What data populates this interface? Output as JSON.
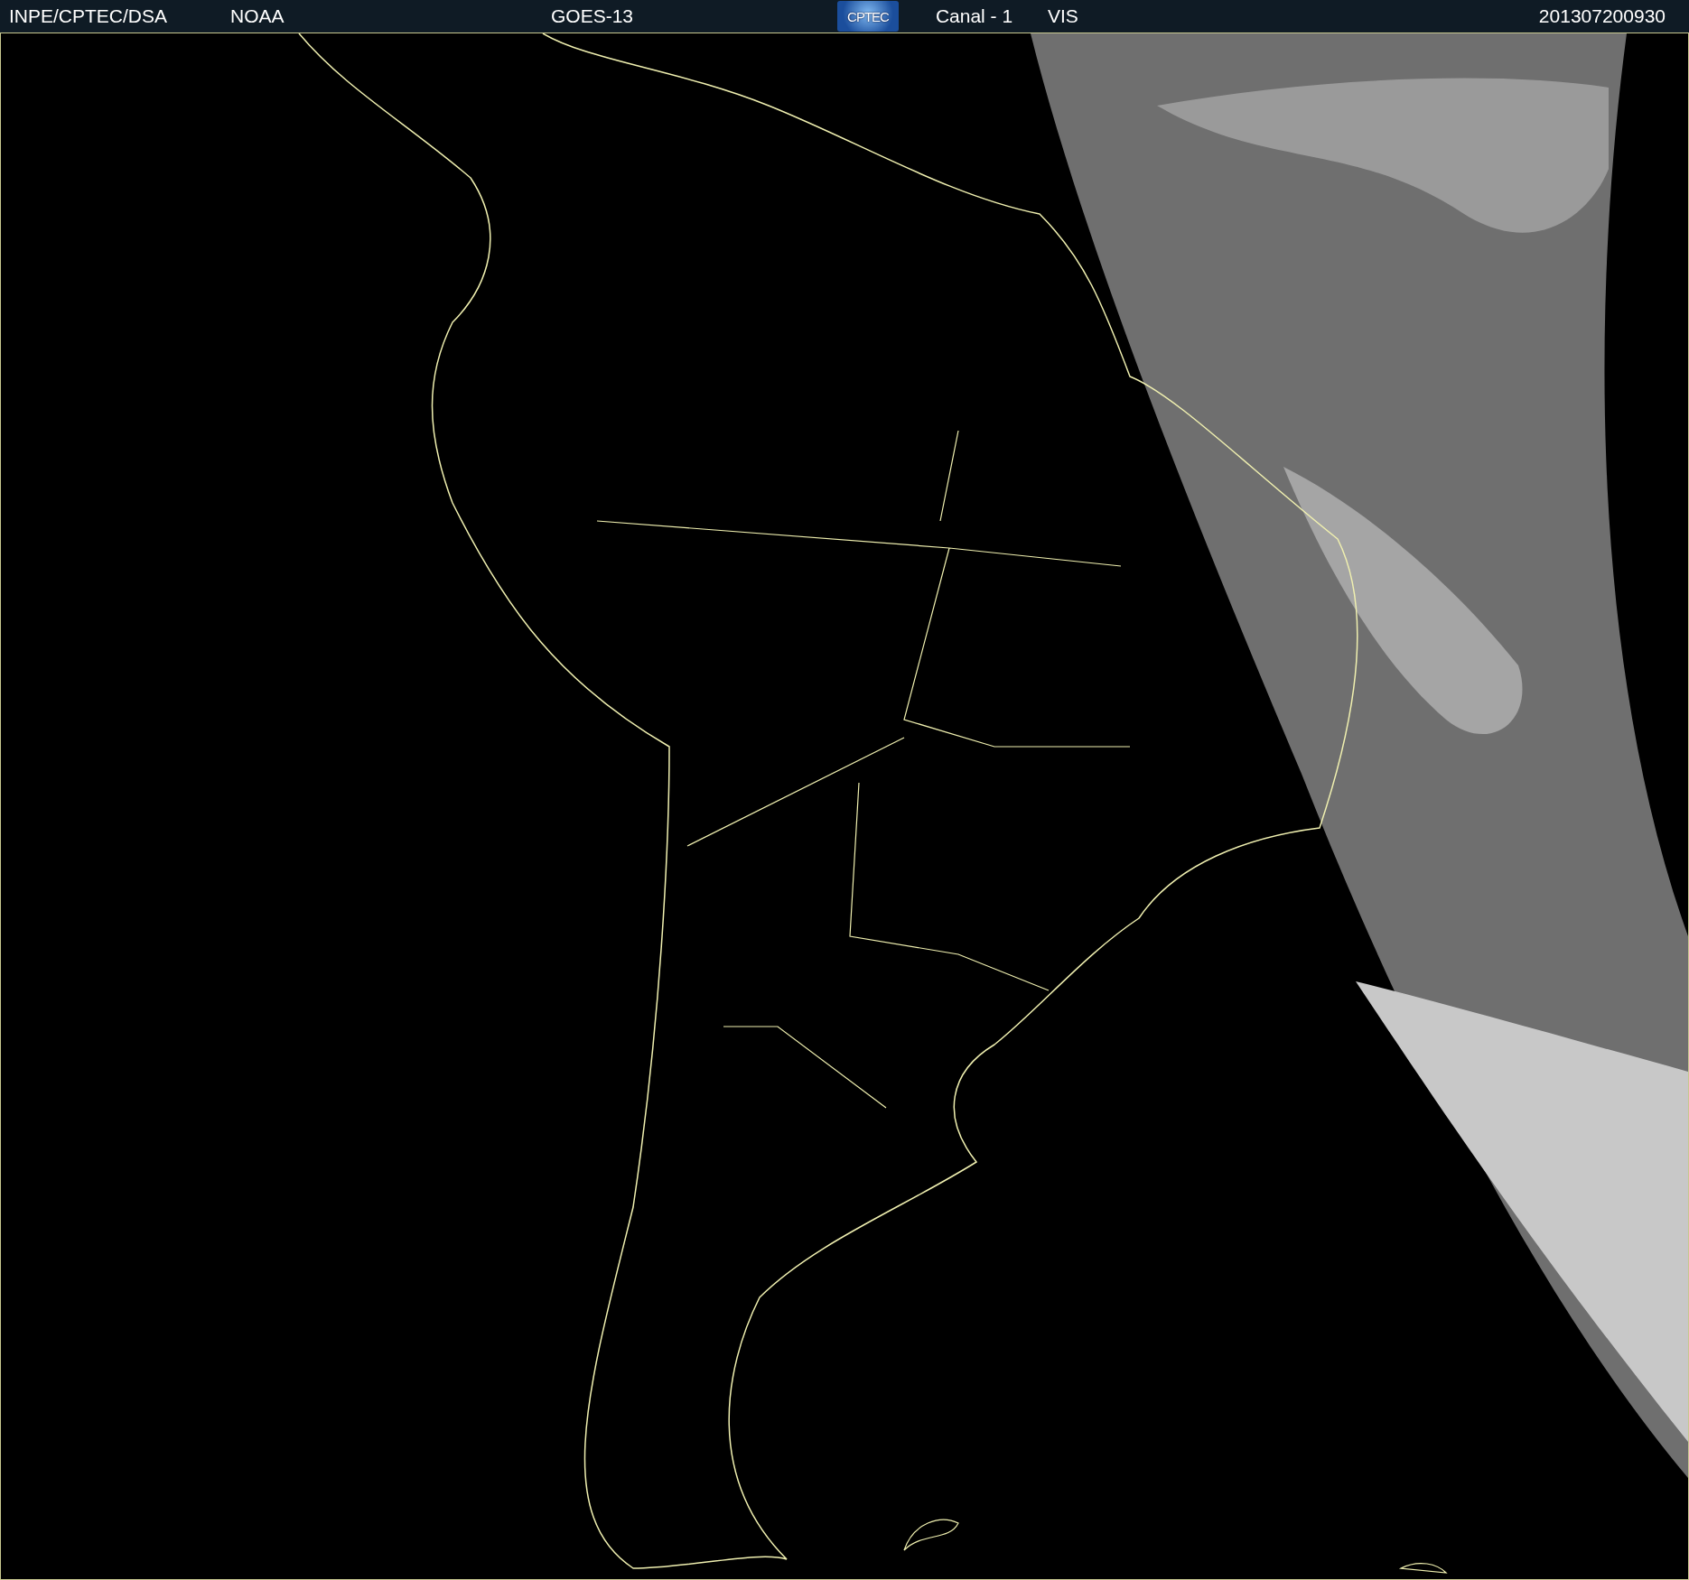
{
  "header": {
    "source": "INPE/CPTEC/DSA",
    "agency": "NOAA",
    "satellite": "GOES-13",
    "logo": "CPTEC",
    "channel": "Canal - 1",
    "band": "VIS",
    "timestamp": "201307200930"
  }
}
